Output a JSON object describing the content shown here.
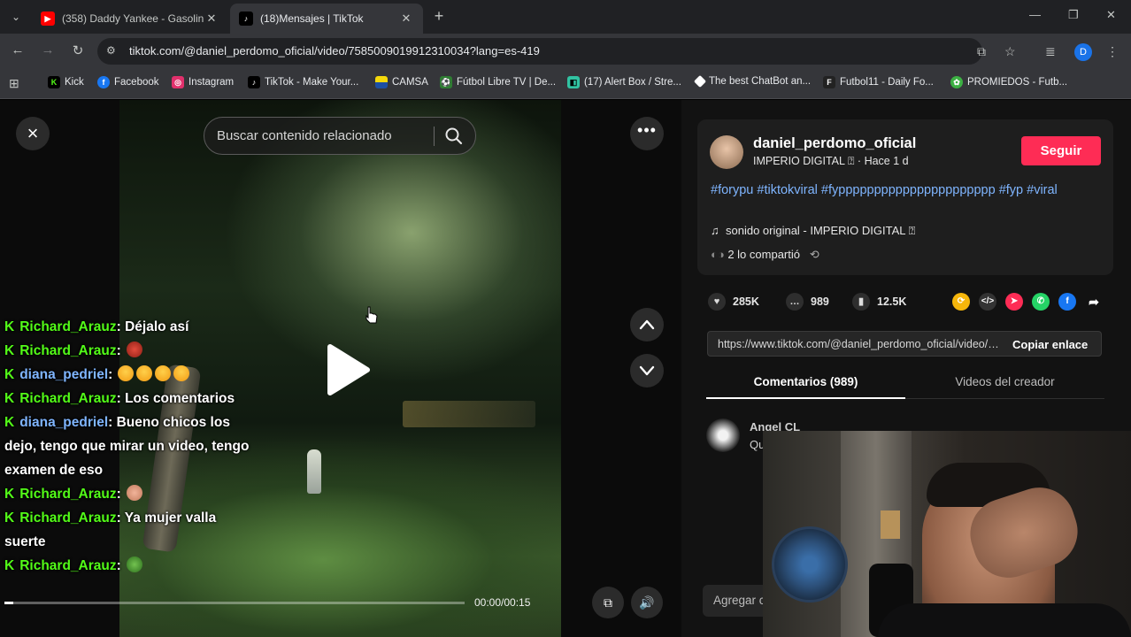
{
  "browser": {
    "tabs": [
      {
        "title": "(358) Daddy Yankee - Gasolina",
        "favicon": "youtube-icon",
        "active": false
      },
      {
        "title": "(18)Mensajes | TikTok",
        "favicon": "tiktok-icon",
        "active": true
      }
    ],
    "url": "tiktok.com/@daniel_perdomo_oficial/video/7585009019912310034?lang=es-419",
    "profile_initial": "D",
    "bookmarks": [
      {
        "label": "Kick",
        "icon": "kick-icon",
        "color": "#53fc18"
      },
      {
        "label": "Facebook",
        "icon": "facebook-icon",
        "color": "#1877f2"
      },
      {
        "label": "Instagram",
        "icon": "instagram-icon",
        "color": "#e1306c"
      },
      {
        "label": "TikTok - Make Your...",
        "icon": "tiktok-icon",
        "color": "#000000"
      },
      {
        "label": "CAMSA",
        "icon": "flag-icon",
        "color": "#f5d90a"
      },
      {
        "label": "Fútbol Libre TV | De...",
        "icon": "soccer-icon",
        "color": "#2e7d32"
      },
      {
        "label": "(17) Alert Box / Stre...",
        "icon": "streamlabs-icon",
        "color": "#31c3a2"
      },
      {
        "label": "The best ChatBot an...",
        "icon": "chatbot-icon",
        "color": "#ffffff"
      },
      {
        "label": "Futbol11 - Daily Fo...",
        "icon": "futbol11-icon",
        "color": "#222222"
      },
      {
        "label": "PROMIEDOS - Futb...",
        "icon": "promiedos-icon",
        "color": "#3cb043"
      }
    ]
  },
  "video": {
    "search_placeholder": "Buscar contenido relacionado",
    "timecode": "00:00/00:15",
    "progress": 0.02
  },
  "chat": [
    {
      "user": "Richard_Arauz",
      "user_color": "green",
      "text": ": Déjalo así",
      "emoji": null
    },
    {
      "user": "Richard_Arauz",
      "user_color": "green",
      "text": ":",
      "emoji": "red"
    },
    {
      "user": "diana_pedriel",
      "user_color": "blue",
      "text": ":",
      "emoji": "grin4"
    },
    {
      "user": "Richard_Arauz",
      "user_color": "green",
      "text": ": Los comentarios",
      "emoji": null
    },
    {
      "user": "diana_pedriel",
      "user_color": "blue",
      "text": ": Bueno chicos los dejo, tengo que mirar un video, tengo examen de eso",
      "emoji": null
    },
    {
      "user": "Richard_Arauz",
      "user_color": "green",
      "text": ":",
      "emoji": "skin"
    },
    {
      "user": "Richard_Arauz",
      "user_color": "green",
      "text": ": Ya mujer valla suerte",
      "emoji": null
    },
    {
      "user": "Richard_Arauz",
      "user_color": "green",
      "text": ":",
      "emoji": "frog"
    }
  ],
  "post": {
    "author": "daniel_perdomo_oficial",
    "subline": "IMPERIO DIGITAL ⍰ · Hace 1 d",
    "follow_label": "Seguir",
    "hashtags": "#forypu #tiktokviral #fypppppppppppppppppppppp #fyp #viral",
    "sound": "sonido original - IMPERIO DIGITAL ⍰",
    "shares": "2 lo compartió",
    "likes": "285K",
    "comments": "989",
    "saves": "12.5K",
    "link": "https://www.tiktok.com/@daniel_perdomo_oficial/video/7585009019912310034",
    "copy_label": "Copiar enlace",
    "tab_comments": "Comentarios (989)",
    "tab_videos": "Videos del creador",
    "comment_author": "Angel CL",
    "comment_text": "Qu",
    "add_comment_placeholder": "Agregar c"
  },
  "colors": {
    "accent": "#fe2c55",
    "hashtag": "#7fb5ff",
    "kick": "#53fc18"
  }
}
